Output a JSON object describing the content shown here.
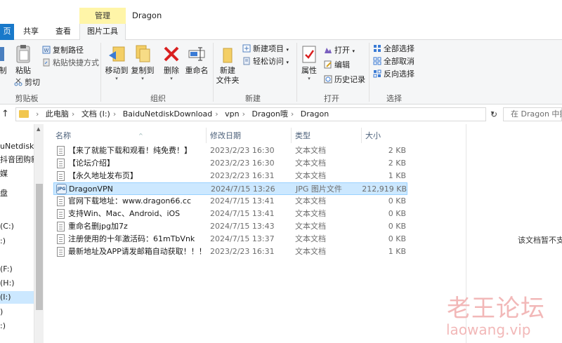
{
  "window": {
    "title": "Dragon",
    "context_tab": "管理"
  },
  "ribbon_tabs": {
    "file": "页",
    "share": "共享",
    "view": "查看",
    "picture_tools": "图片工具"
  },
  "ribbon": {
    "clipboard": {
      "cut_partial": "制",
      "paste": "粘贴",
      "copy_path": "复制路径",
      "paste_shortcut": "粘贴快捷方式",
      "cut": "剪切",
      "group": "剪贴板"
    },
    "organize": {
      "move_to": "移动到",
      "copy_to": "复制到",
      "delete": "删除",
      "rename": "重命名",
      "group": "组织"
    },
    "new": {
      "new_folder_line1": "新建",
      "new_folder_line2": "文件夹",
      "new_item": "新建项目",
      "easy_access": "轻松访问",
      "group": "新建"
    },
    "open": {
      "properties": "属性",
      "open": "打开",
      "edit": "编辑",
      "history": "历史记录",
      "group": "打开"
    },
    "select": {
      "select_all": "全部选择",
      "select_none": "全部取消",
      "invert": "反向选择",
      "group": "选择"
    }
  },
  "address": {
    "crumbs": [
      "此电脑",
      "文档 (I:)",
      "BaiduNetdiskDownload",
      "vpn",
      "Dragon哦",
      "Dragon"
    ],
    "search_placeholder": "在 Dragon 中搜索"
  },
  "nav_pane": {
    "items": [
      {
        "label": "uNetdiskD"
      },
      {
        "label": "抖音团购新"
      },
      {
        "label": "媒"
      },
      {
        "label": "盘"
      },
      {
        "label": "(C:)"
      },
      {
        "label": ":)"
      },
      {
        "label": "(F:)"
      },
      {
        "label": "(H:)"
      },
      {
        "label": "(I:)"
      },
      {
        "label": ")"
      },
      {
        "label": ":)"
      }
    ]
  },
  "columns": {
    "name": "名称",
    "date": "修改日期",
    "type": "类型",
    "size": "大小"
  },
  "files": [
    {
      "name": "【来了就能下载和观看！纯免费！】",
      "date": "2023/2/23 16:30",
      "type": "文本文档",
      "size": "2 KB",
      "icon": "text-file-icon"
    },
    {
      "name": "【论坛介绍】",
      "date": "2023/2/23 16:30",
      "type": "文本文档",
      "size": "2 KB",
      "icon": "text-file-icon"
    },
    {
      "name": "【永久地址发布页】",
      "date": "2023/2/23 16:31",
      "type": "文本文档",
      "size": "1 KB",
      "icon": "text-file-icon"
    },
    {
      "name": "DragonVPN",
      "date": "2024/7/15 13:26",
      "type": "JPG 图片文件",
      "size": "212,919 KB",
      "icon": "jpg-file-icon",
      "selected": true
    },
    {
      "name": "官网下载地址：www.dragon66.cc",
      "date": "2024/7/15 13:41",
      "type": "文本文档",
      "size": "0 KB",
      "icon": "text-file-icon"
    },
    {
      "name": "支持Win、Mac、Android、iOS",
      "date": "2024/7/15 13:41",
      "type": "文本文档",
      "size": "0 KB",
      "icon": "text-file-icon"
    },
    {
      "name": "重命名删jpg加7z",
      "date": "2024/7/15 13:43",
      "type": "文本文档",
      "size": "0 KB",
      "icon": "text-file-icon"
    },
    {
      "name": "注册使用的十年激活码：61mTbVnk",
      "date": "2024/7/15 13:37",
      "type": "文本文档",
      "size": "0 KB",
      "icon": "text-file-icon"
    },
    {
      "name": "最新地址及APP请发邮箱自动获取！！！",
      "date": "2023/2/23 16:31",
      "type": "文本文档",
      "size": "1 KB",
      "icon": "text-file-icon"
    }
  ],
  "preview": {
    "message": "该文档暂不支持"
  },
  "watermark": {
    "line1": "老王论坛",
    "line2": "laowang.vip"
  }
}
